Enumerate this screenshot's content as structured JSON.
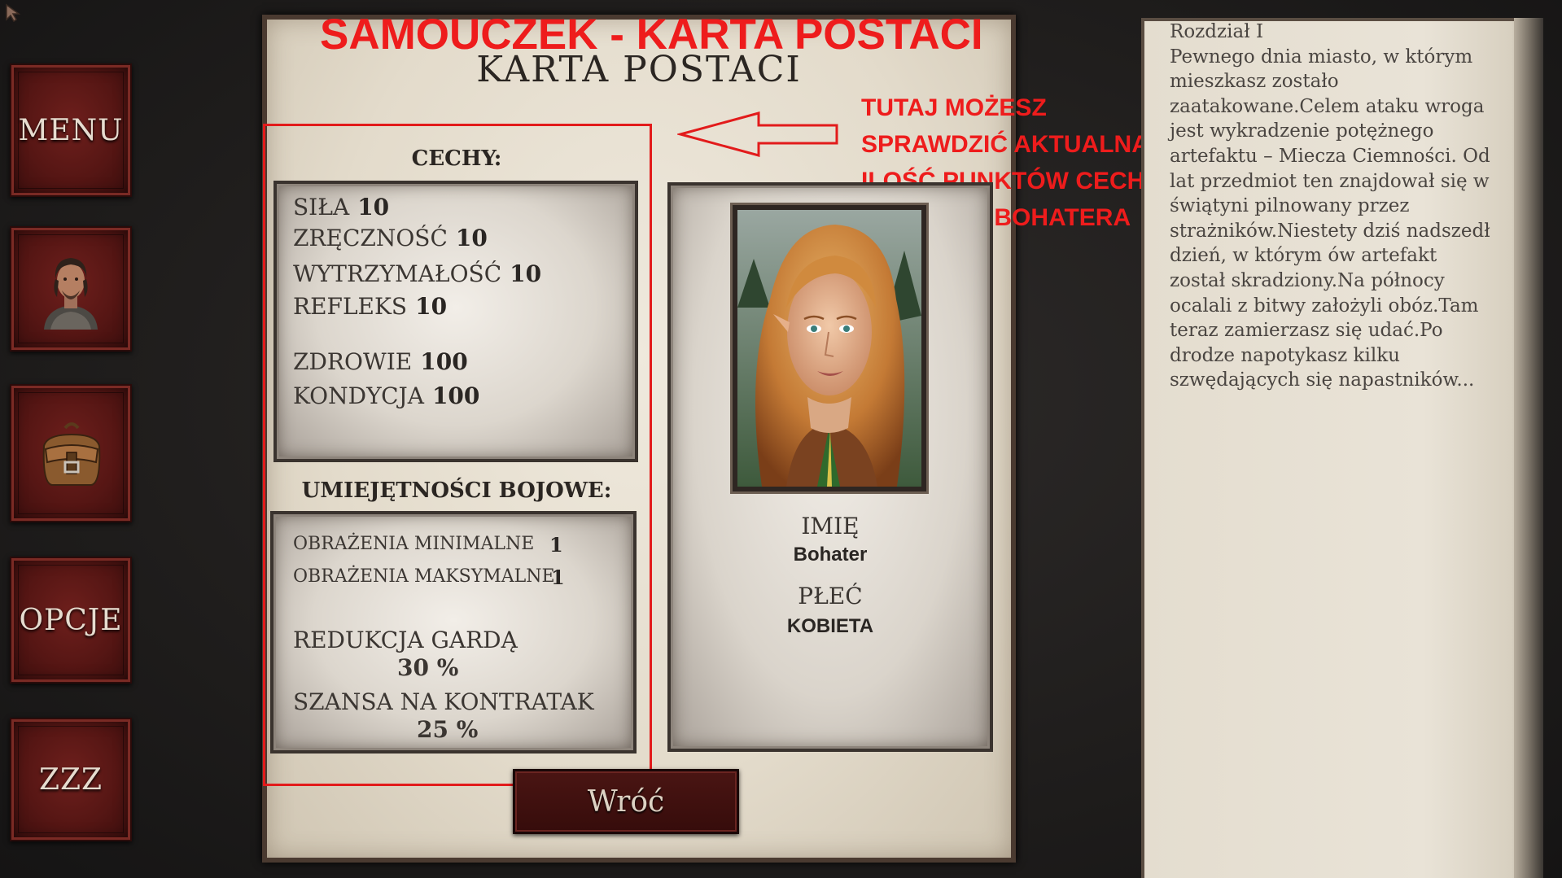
{
  "tutorial": {
    "title": "SAMOUCZEK - KARTA POSTACI",
    "note_lines": [
      "TUTAJ MOŻESZ",
      "SPRAWDZIĆ AKTUALNĄ",
      "ILOŚĆ PUNKTÓW CECH",
      "SWOJEGO BOHATERA"
    ]
  },
  "sidebar": {
    "menu_label": "MENU",
    "character_icon": "hero-portrait-icon",
    "inventory_icon": "backpack-icon",
    "options_label": "OPCJE",
    "sleep_label": "ZZZ"
  },
  "card": {
    "title": "KARTA POSTACI",
    "traits_heading": "CECHY:",
    "traits": {
      "strength_label": "SIŁA",
      "strength_value": "10",
      "dexterity_label": "ZRĘCZNOŚĆ",
      "dexterity_value": "10",
      "endurance_label": "WYTRZYMAŁOŚĆ",
      "endurance_value": "10",
      "reflex_label": "REFLEKS",
      "reflex_value": "10",
      "health_label": "ZDROWIE",
      "health_value": "100",
      "stamina_label": "KONDYCJA",
      "stamina_value": "100"
    },
    "combat_heading": "UMIEJĘTNOŚCI BOJOWE:",
    "combat": {
      "min_damage_label": "OBRAŻENIA MINIMALNE",
      "min_damage_value": "1",
      "max_damage_label": "OBRAŻENIA MAKSYMALNE",
      "max_damage_value": "1",
      "guard_label": "REDUKCJA GARDĄ",
      "guard_value": "30 %",
      "counter_label": "SZANSA NA KONTRATAK",
      "counter_value": "25 %"
    },
    "name_label": "IMIĘ",
    "name_value": "Bohater",
    "gender_label": "PŁEĆ",
    "gender_value": "KOBIETA",
    "back_button": "Wróć"
  },
  "story": {
    "lines": [
      "Rozdział I",
      "Pewnego dnia miasto, w którym",
      "mieszkasz zostało",
      "zaatakowane.Celem ataku wroga",
      "jest wykradzenie potężnego",
      "artefaktu – Miecza Ciemności. Od",
      "lat przedmiot ten znajdował się w",
      "świątyni pilnowany przez",
      "strażników.Niestety dziś nadszedł",
      "dzień, w którym ów artefakt",
      "został skradziony.Na północy",
      "ocalali z bitwy założyli obóz.Tam",
      "teraz zamierzasz się udać.Po",
      "drodze napotykasz kilku",
      "szwędających się napastników..."
    ]
  },
  "colors": {
    "tutorial_red": "#ee1c1c",
    "button_red": "#561614",
    "parchment": "#e3dbcb"
  }
}
